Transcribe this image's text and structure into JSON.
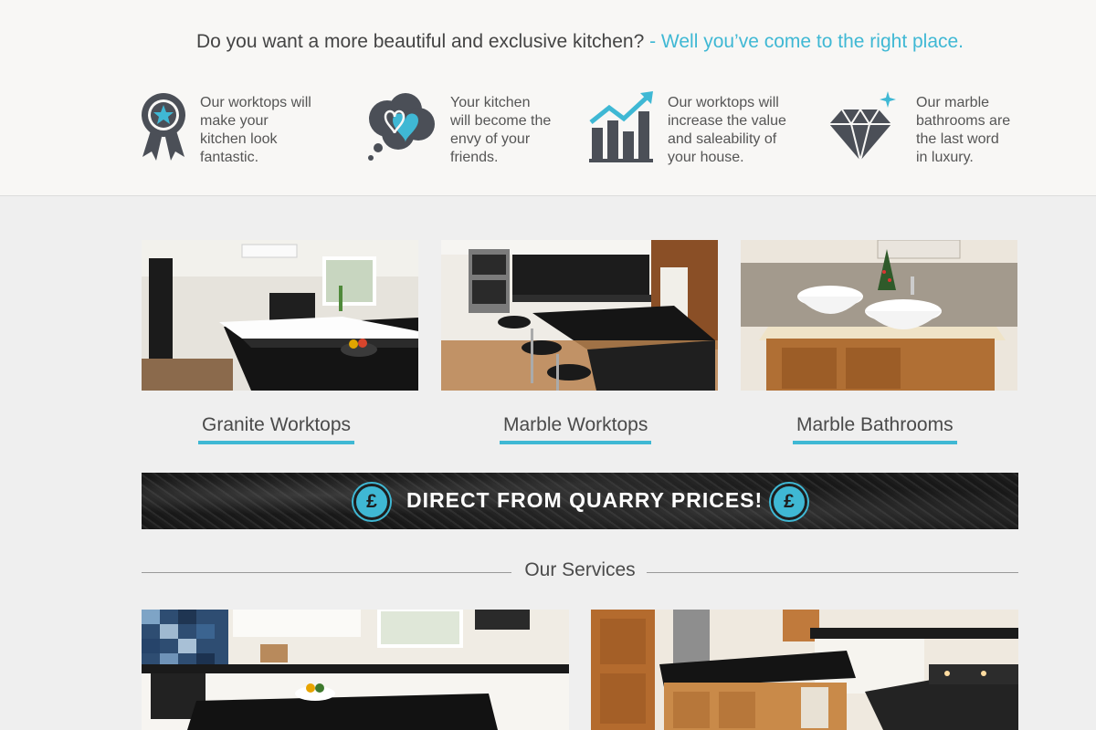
{
  "hero": {
    "question": "Do you want a more beautiful and exclusive kitchen?",
    "answer": " - Well you’ve come to the right place."
  },
  "features": [
    {
      "icon": "award-ribbon-icon",
      "lines": [
        "Our worktops will",
        "make your",
        "kitchen look",
        "fantastic."
      ]
    },
    {
      "icon": "heart-thought-bubble-icon",
      "lines": [
        "Your kitchen",
        "will become the",
        "envy of your",
        "friends."
      ]
    },
    {
      "icon": "rising-chart-icon",
      "lines": [
        "Our worktops will",
        "increase the value",
        "and saleability of",
        "your house."
      ]
    },
    {
      "icon": "diamond-icon",
      "lines": [
        "Our marble",
        "bathrooms are",
        "the last word",
        "in luxury."
      ]
    }
  ],
  "categories": [
    {
      "label": "Granite Worktops",
      "image": "granite-kitchen-photo"
    },
    {
      "label": "Marble Worktops",
      "image": "marble-kitchen-photo"
    },
    {
      "label": "Marble Bathrooms",
      "image": "marble-bathroom-photo"
    }
  ],
  "banner": {
    "text": "DIRECT FROM QUARRY PRICES!",
    "symbol": "£"
  },
  "services": {
    "title": "Our Services",
    "images": [
      "kitchen-island-photo",
      "wood-kitchen-photo"
    ]
  },
  "colors": {
    "accent": "#3fb8d4",
    "icon_dark": "#4b4f57",
    "background": "#efefef",
    "top_band": "#f8f7f5"
  }
}
